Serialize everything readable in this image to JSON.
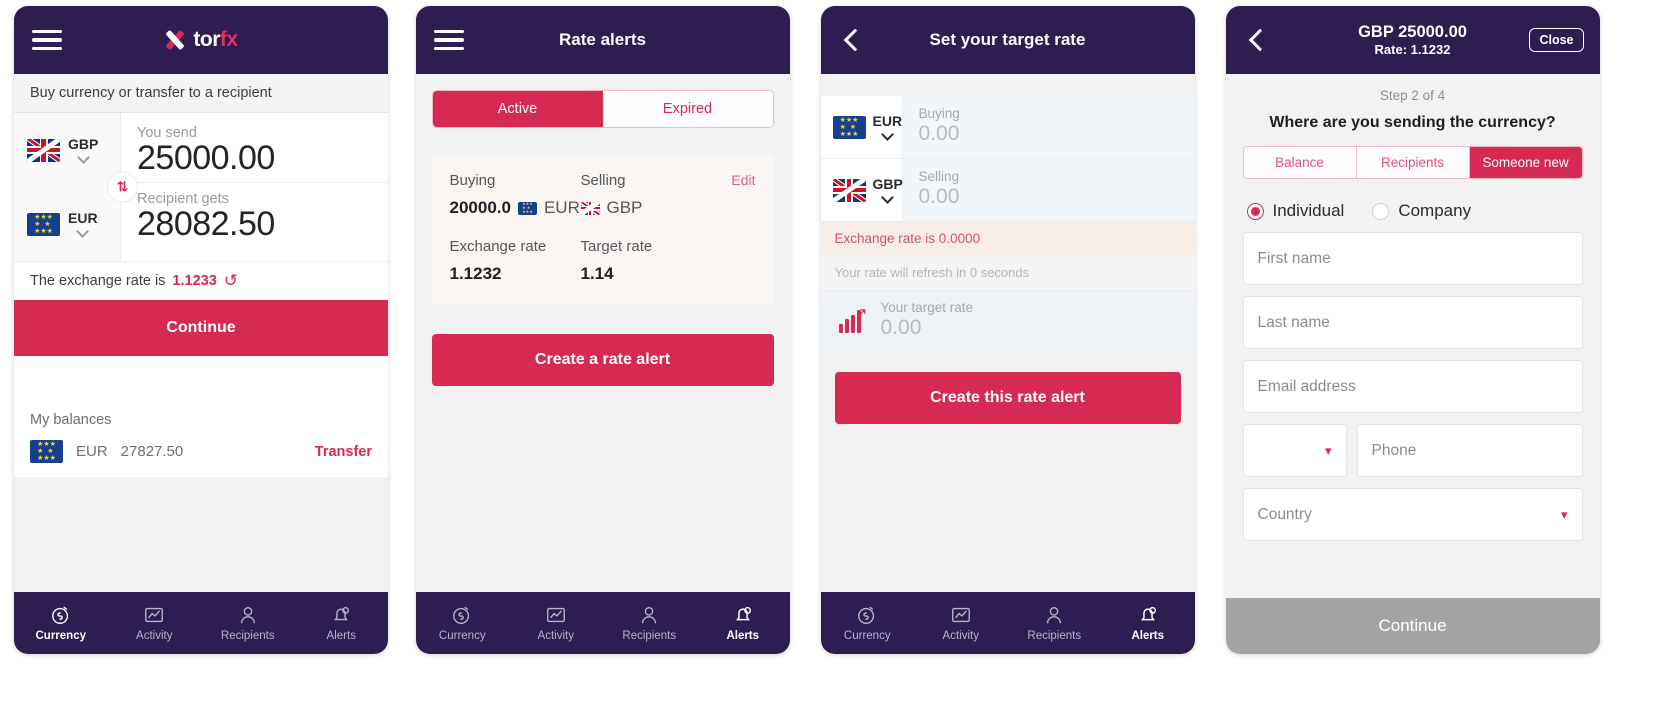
{
  "brand": {
    "accent": "#d62a53",
    "header_bg": "#2d1d51",
    "logo_tor": "tor",
    "logo_fx": "fx"
  },
  "screen1": {
    "name": "currency-home",
    "header": {
      "menu_icon": "hamburger-icon",
      "logo": "torfx-logo"
    },
    "subtitle": "Buy currency or transfer to a recipient",
    "send": {
      "currency": "GBP",
      "flag": "gb-flag",
      "label": "You send",
      "value": "25000.00"
    },
    "receive": {
      "currency": "EUR",
      "flag": "eu-flag",
      "label": "Recipient gets",
      "value": "28082.50"
    },
    "swap_icon": "swap-vertical-icon",
    "rate_text": "The exchange rate is",
    "rate_value": "1.1233",
    "refresh_icon": "refresh-icon",
    "continue_label": "Continue",
    "balances_title": "My balances",
    "balance": {
      "flag": "eu-flag",
      "currency": "EUR",
      "amount": "27827.50",
      "action": "Transfer"
    },
    "nav": [
      {
        "label": "Currency",
        "icon": "currency-clock-icon",
        "active": true
      },
      {
        "label": "Activity",
        "icon": "chart-icon",
        "active": false
      },
      {
        "label": "Recipients",
        "icon": "person-icon",
        "active": false
      },
      {
        "label": "Alerts",
        "icon": "bell-icon",
        "active": false
      }
    ]
  },
  "screen2": {
    "name": "rate-alerts",
    "header": {
      "menu_icon": "hamburger-icon",
      "title": "Rate alerts"
    },
    "tabs": [
      {
        "label": "Active",
        "active": true
      },
      {
        "label": "Expired",
        "active": false
      }
    ],
    "card": {
      "buying_label": "Buying",
      "buying_amount": "20000.0",
      "buying_currency": "EUR",
      "buying_flag": "eu-flag",
      "selling_label": "Selling",
      "selling_currency": "GBP",
      "selling_flag": "gb-flag",
      "edit_label": "Edit",
      "exchange_rate_label": "Exchange rate",
      "exchange_rate_value": "1.1232",
      "target_rate_label": "Target rate",
      "target_rate_value": "1.14"
    },
    "cta_label": "Create a rate alert",
    "nav": [
      {
        "label": "Currency",
        "icon": "currency-clock-icon",
        "active": false
      },
      {
        "label": "Activity",
        "icon": "chart-icon",
        "active": false
      },
      {
        "label": "Recipients",
        "icon": "person-icon",
        "active": false
      },
      {
        "label": "Alerts",
        "icon": "bell-icon",
        "active": true
      }
    ]
  },
  "screen3": {
    "name": "set-target-rate",
    "header": {
      "back_icon": "chevron-left-icon",
      "title": "Set your target rate"
    },
    "buy_row": {
      "flag": "eu-flag",
      "currency": "EUR",
      "label": "Buying",
      "value": "0.00"
    },
    "sell_row": {
      "flag": "gb-flag",
      "currency": "GBP",
      "label": "Selling",
      "value": "0.00"
    },
    "rate_note": "Exchange rate is 0.0000",
    "refresh_note": "Your rate will refresh in 0 seconds",
    "target": {
      "icon": "bar-chart-up-icon",
      "label": "Your target rate",
      "value": "0.00"
    },
    "cta_label": "Create this rate alert",
    "nav": [
      {
        "label": "Currency",
        "icon": "currency-clock-icon",
        "active": false
      },
      {
        "label": "Activity",
        "icon": "chart-icon",
        "active": false
      },
      {
        "label": "Recipients",
        "icon": "person-icon",
        "active": false
      },
      {
        "label": "Alerts",
        "icon": "bell-icon",
        "active": true
      }
    ]
  },
  "screen4": {
    "name": "send-currency-step2",
    "header": {
      "back_icon": "chevron-left-icon",
      "title_line1": "GBP 25000.00",
      "title_line2": "Rate: 1.1232",
      "close_label": "Close"
    },
    "step_counter": "Step 2 of 4",
    "question": "Where are you sending the currency?",
    "destination_tabs": [
      {
        "label": "Balance",
        "active": false
      },
      {
        "label": "Recipients",
        "active": false
      },
      {
        "label": "Someone new",
        "active": true
      }
    ],
    "entity_options": [
      {
        "label": "Individual",
        "selected": true
      },
      {
        "label": "Company",
        "selected": false
      }
    ],
    "fields": [
      {
        "name": "first-name-field",
        "placeholder": "First name",
        "value": ""
      },
      {
        "name": "last-name-field",
        "placeholder": "Last name",
        "value": ""
      },
      {
        "name": "email-field",
        "placeholder": "Email address",
        "value": ""
      }
    ],
    "dial_code": {
      "name": "dial-code-select",
      "value": ""
    },
    "phone": {
      "name": "phone-field",
      "placeholder": "Phone",
      "value": ""
    },
    "country": {
      "name": "country-select",
      "placeholder": "Country",
      "value": ""
    },
    "continue_label": "Continue",
    "nav": [
      {
        "label": "Currency",
        "icon": "currency-clock-icon",
        "active": false
      },
      {
        "label": "Activity",
        "icon": "chart-icon",
        "active": false
      },
      {
        "label": "Recipients",
        "icon": "person-icon",
        "active": false
      },
      {
        "label": "Alerts",
        "icon": "bell-icon",
        "active": true
      }
    ]
  }
}
